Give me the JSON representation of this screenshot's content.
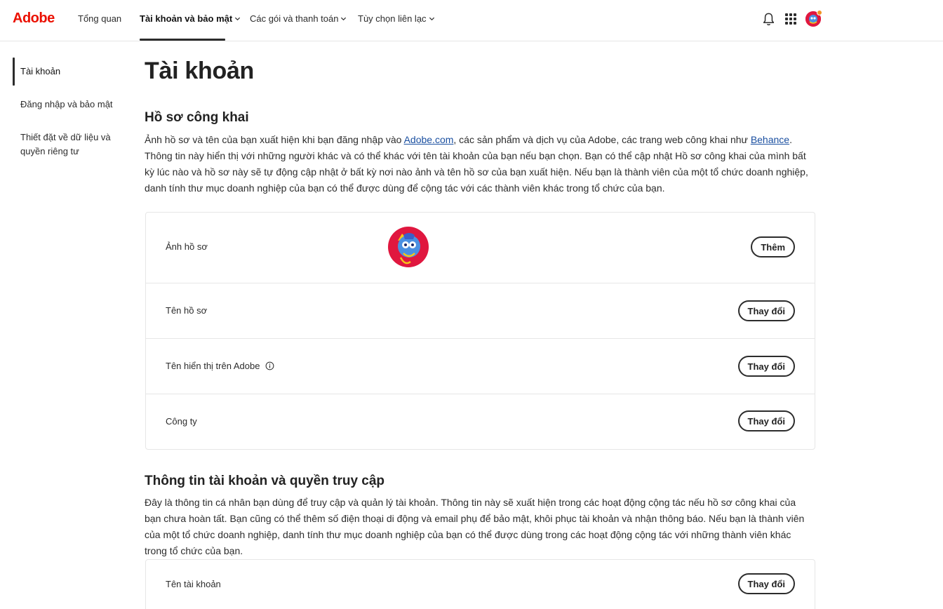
{
  "brand": {
    "logo_text": "Adobe",
    "accent": "#eb1000"
  },
  "nav": {
    "items": [
      {
        "label": "Tổng quan"
      },
      {
        "label": "Tài khoản và bảo mật",
        "active": true
      },
      {
        "label": "Các gói và thanh toán"
      },
      {
        "label": "Tùy chọn liên lạc"
      }
    ],
    "icons": [
      "bell-icon",
      "apps-grid-icon",
      "user-avatar"
    ]
  },
  "sidebar": {
    "items": [
      {
        "label": "Tài khoản",
        "active": true
      },
      {
        "label": "Đăng nhập và bảo mật"
      },
      {
        "label": "Thiết đặt về dữ liệu và quyền riêng tư"
      }
    ]
  },
  "main": {
    "title": "Tài khoản",
    "public_profile": {
      "heading": "Hồ sơ công khai",
      "desc_1": "Ảnh hồ sơ và tên của bạn xuất hiện khi bạn đăng nhập vào ",
      "link_adobe": "Adobe.com",
      "desc_2": ", các sản phẩm và dịch vụ của Adobe, các trang web công khai như ",
      "link_behance": "Behance",
      "desc_3": ". Thông tin này hiển thị với những người khác và có thể khác với tên tài khoản của bạn nếu bạn chọn. Bạn có thể cập nhật Hồ sơ công khai của mình bất kỳ lúc nào và hồ sơ này sẽ tự động cập nhật ở bất kỳ nơi nào ảnh và tên hồ sơ của bạn xuất hiện. Nếu bạn là thành viên của một tổ chức doanh nghiệp, danh tính thư mục doanh nghiệp của bạn có thể được dùng để cộng tác với các thành viên khác trong tổ chức của bạn.",
      "rows": [
        {
          "label": "Ảnh hồ sơ",
          "button": "Thêm"
        },
        {
          "label": "Tên hồ sơ",
          "button": "Thay đổi"
        },
        {
          "label": "Tên hiển thị trên Adobe",
          "button": "Thay đổi"
        },
        {
          "label": "Công ty",
          "button": "Thay đổi"
        }
      ]
    },
    "account_info": {
      "heading": "Thông tin tài khoản và quyền truy cập",
      "desc": "Đây là thông tin cá nhân bạn dùng để truy cập và quản lý tài khoản. Thông tin này sẽ xuất hiện trong các hoạt động cộng tác nếu hồ sơ công khai của bạn chưa hoàn tất. Bạn cũng có thể thêm số điện thoại di động và email phụ để bảo mật, khôi phục tài khoản và nhận thông báo. Nếu bạn là thành viên của một tổ chức doanh nghiệp, danh tính thư mục doanh nghiệp của bạn có thể được dùng trong các hoạt động cộng tác với những thành viên khác trong tổ chức của bạn.",
      "rows": [
        {
          "label": "Tên tài khoản",
          "button": "Thay đổi"
        }
      ]
    }
  }
}
